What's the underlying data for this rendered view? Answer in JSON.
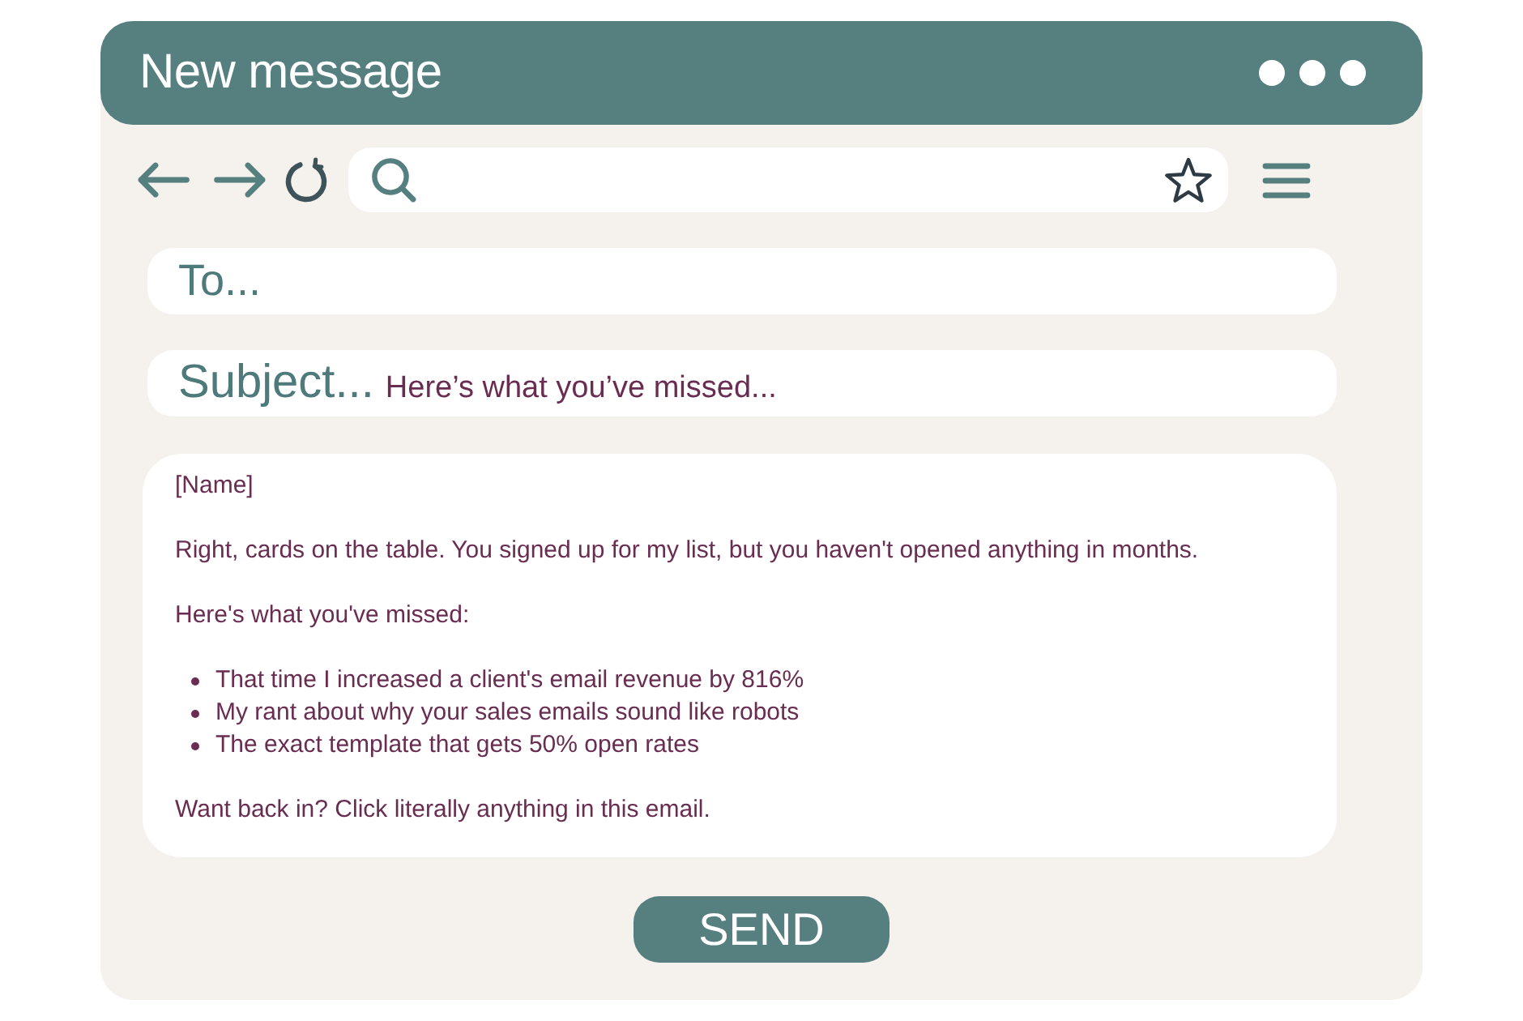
{
  "window": {
    "title": "New message"
  },
  "to_field": {
    "label": "To..."
  },
  "subject_field": {
    "label": "Subject...",
    "value": "Here’s what you’ve missed..."
  },
  "body": {
    "blocks": [
      {
        "kind": "paragraph",
        "text": "[Name]"
      },
      {
        "kind": "paragraph",
        "text": "Right, cards on the table. You signed up for my list, but you haven't opened anything in months."
      },
      {
        "kind": "paragraph",
        "text": "Here's what you've missed:"
      },
      {
        "kind": "list",
        "items": [
          "That time I increased a client's email revenue by 816%",
          "My rant about why your sales emails sound like robots",
          "The exact template that gets 50% open rates"
        ]
      },
      {
        "kind": "paragraph",
        "text": "Want back in? Click literally anything in this email."
      }
    ]
  },
  "send_button": {
    "label": "SEND"
  }
}
